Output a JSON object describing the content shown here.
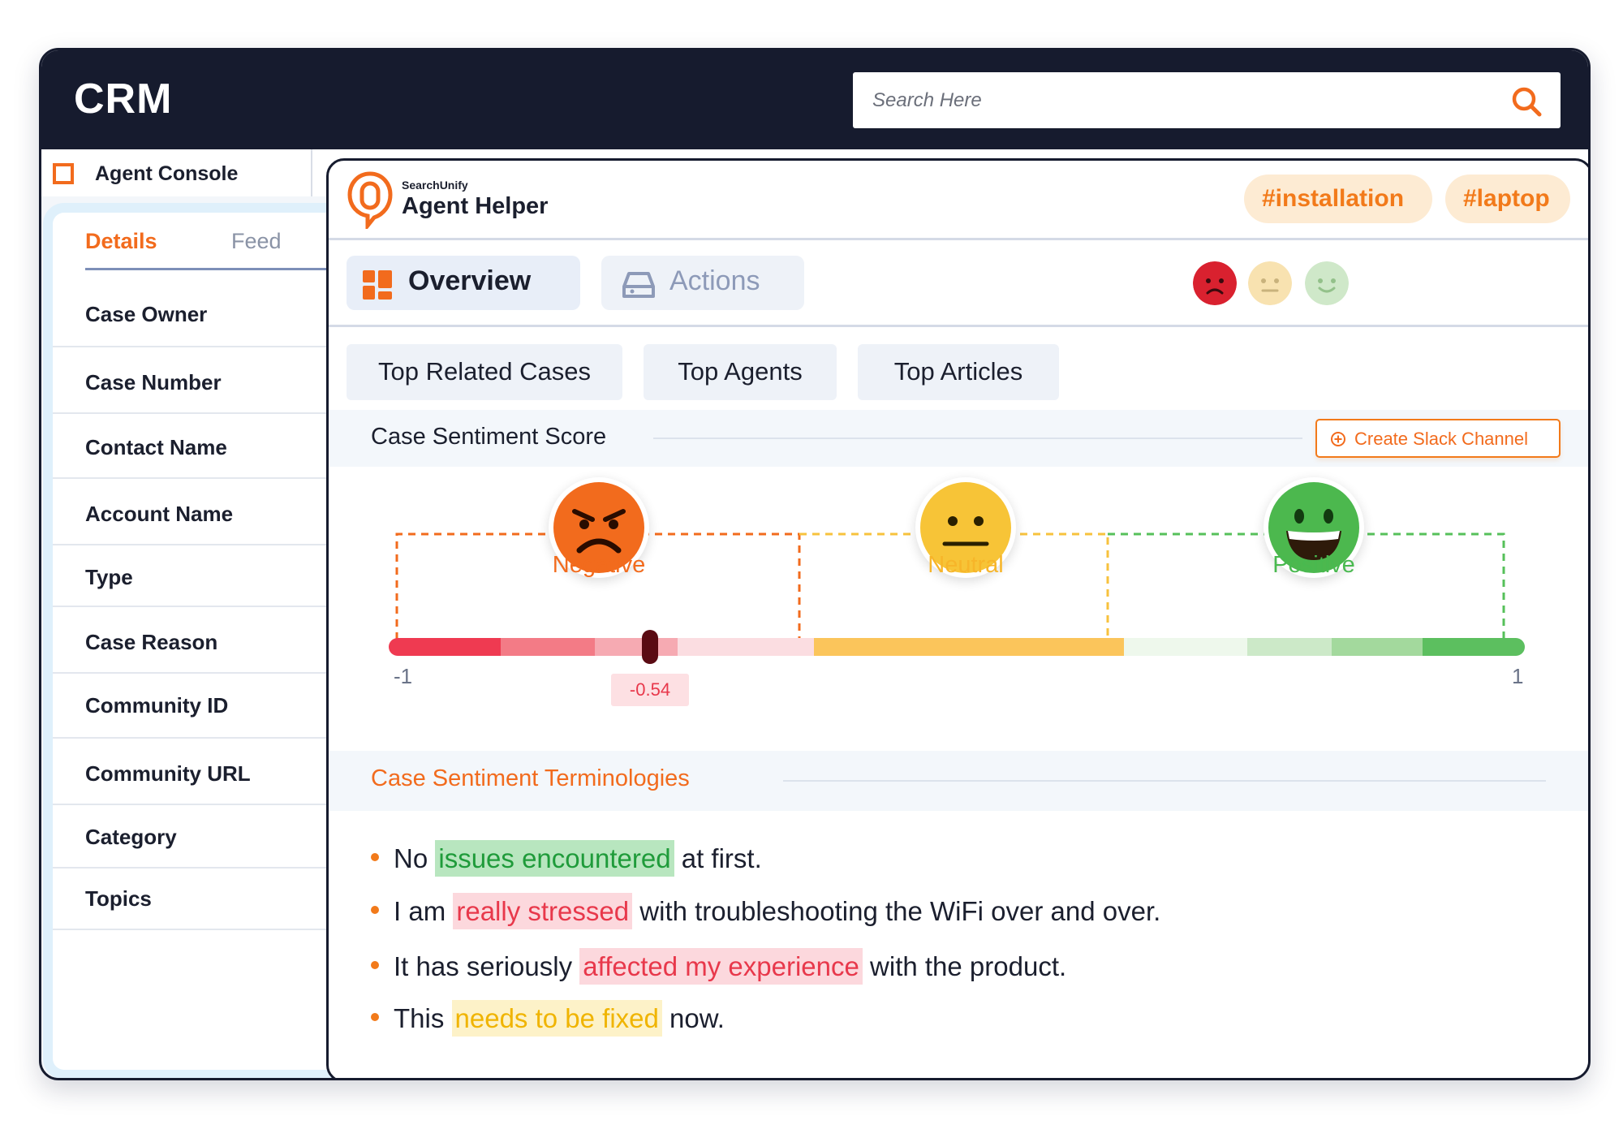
{
  "app": {
    "title": "CRM"
  },
  "search": {
    "placeholder": "Search Here"
  },
  "console": {
    "tab_label": "Agent Console"
  },
  "left_panel": {
    "tabs": [
      "Details",
      "Feed"
    ],
    "fields": [
      "Case Owner",
      "Case Number",
      "Contact Name",
      "Account Name",
      "Type",
      "Case Reason",
      "Community ID",
      "Community URL",
      "Category",
      "Topics"
    ]
  },
  "helper": {
    "brand_sub": "SearchUnify",
    "brand_title": "Agent Helper",
    "tags": [
      "#installation",
      "#laptop"
    ],
    "nav": {
      "overview": "Overview",
      "actions": "Actions"
    },
    "subtabs": [
      "Top Related Cases",
      "Top Agents",
      "Top Articles"
    ],
    "sentiment": {
      "title": "Case Sentiment Score",
      "slack_button": "Create Slack Channel",
      "negative": "Negative",
      "neutral": "Neutral",
      "positive": "Positive",
      "min": "-1",
      "max": "1",
      "score": "-0.54",
      "score_value": -0.54,
      "colors": {
        "negative": "#f26b1d",
        "neutral": "#f7b529",
        "positive": "#49b94f"
      }
    },
    "terminology": {
      "title": "Case Sentiment Terminologies",
      "items": [
        {
          "pre": "No ",
          "hl": "issues encountered",
          "post": " at first.",
          "tone": "green"
        },
        {
          "pre": "I am ",
          "hl": "really stressed",
          "post": " with troubleshooting the WiFi over and over.",
          "tone": "red"
        },
        {
          "pre": "It has seriously ",
          "hl": "affected my experience",
          "post": " with the product.",
          "tone": "red"
        },
        {
          "pre": "This ",
          "hl": "needs to be fixed",
          "post": " now.",
          "tone": "yellow"
        }
      ]
    }
  }
}
